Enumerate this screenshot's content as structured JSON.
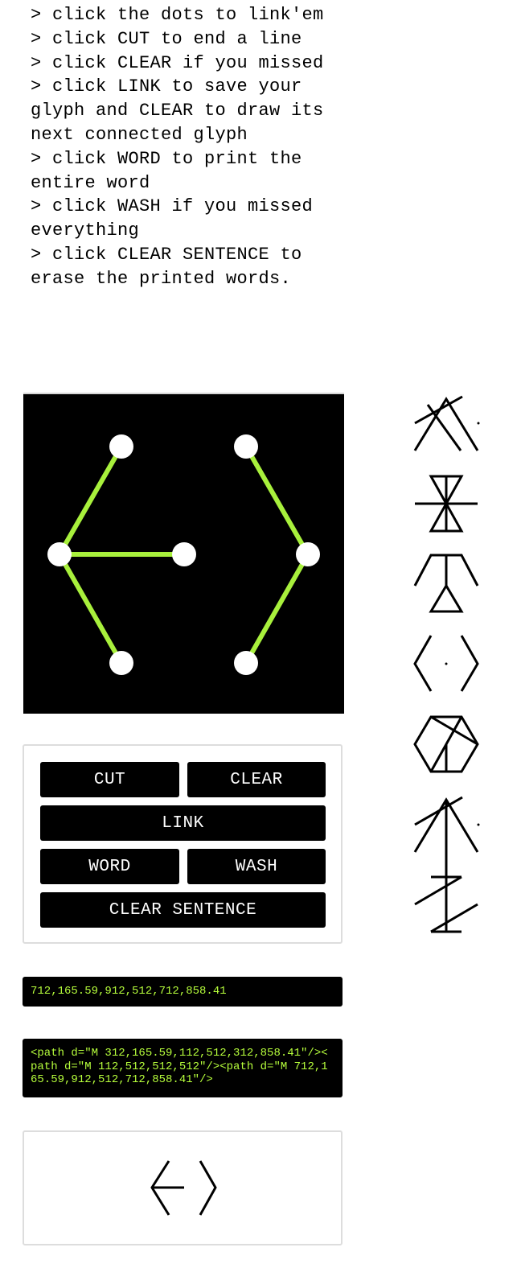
{
  "instructions": [
    "> click the dots to link'em",
    "> click CUT to end a line",
    "> click CLEAR if you missed",
    "> click LINK to save your glyph and CLEAR to draw its next connected glyph",
    "> click WORD to print the entire word",
    "> click WASH if you missed everything",
    "> click CLEAR SENTENCE to erase the printed words."
  ],
  "buttons": {
    "cut": "CUT",
    "clear": "CLEAR",
    "link": "LINK",
    "word": "WORD",
    "wash": "WASH",
    "clear_sentence": "CLEAR SENTENCE"
  },
  "coords_output": "712,165.59,912,512,712,858.41",
  "path_output": "<path d=\"M 312,165.59,112,512,312,858.41\"/><path d=\"M 112,512,512,512\"/><path d=\"M 712,165.59,912,512,712,858.41\"/>",
  "colors": {
    "canvas_bg": "#000000",
    "line": "#a8f03c",
    "dot": "#ffffff",
    "output_text": "#b7ff3c",
    "button_bg": "#000000",
    "button_text": "#ffffff"
  }
}
